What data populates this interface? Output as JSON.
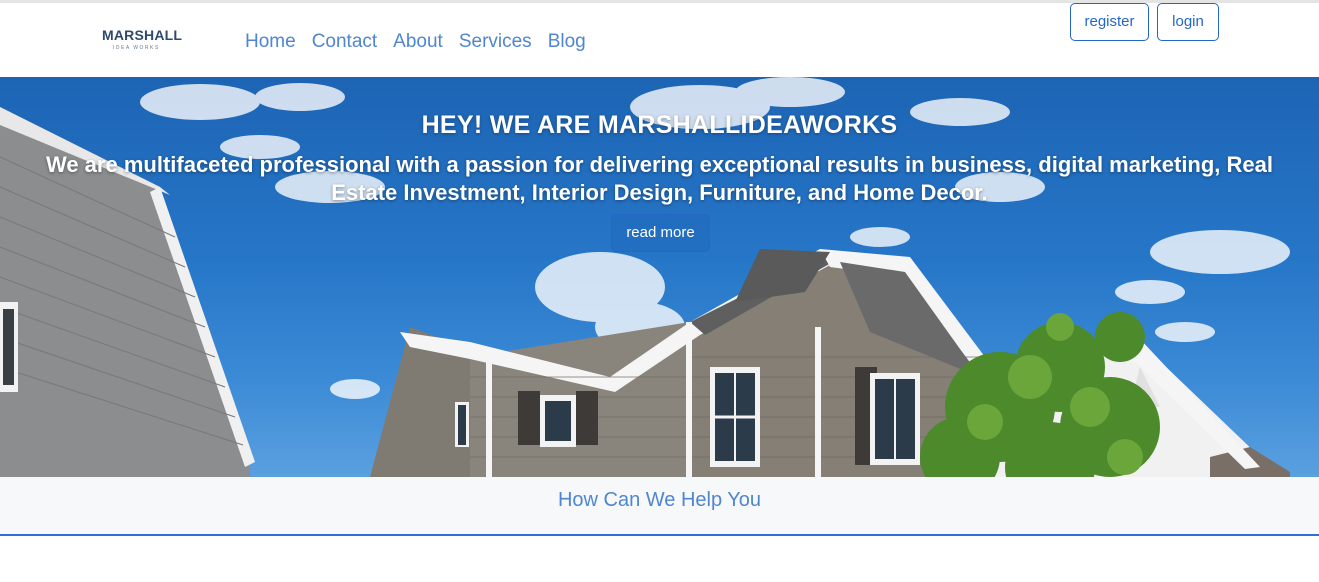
{
  "brand": {
    "logo_main": "MARSHALL",
    "logo_sub": "IDEA WORKS",
    "color": "#2f4a6b"
  },
  "nav": {
    "links": [
      "Home",
      "Contact",
      "About",
      "Services",
      "Blog"
    ],
    "link_color": "#4f86cf"
  },
  "auth": {
    "register_label": "register",
    "login_label": "login",
    "accent": "#2566c7"
  },
  "hero": {
    "title": "HEY! WE ARE MARSHALLIDEAWORKS",
    "text": "We are multifaceted professional with a passion for delivering exceptional results in business, digital marketing, Real Estate Investment, Interior Design, Furniture, and Home Decor.",
    "button_label": "read more",
    "image": "house-photo"
  },
  "help": {
    "title": "How Can We Help You"
  }
}
